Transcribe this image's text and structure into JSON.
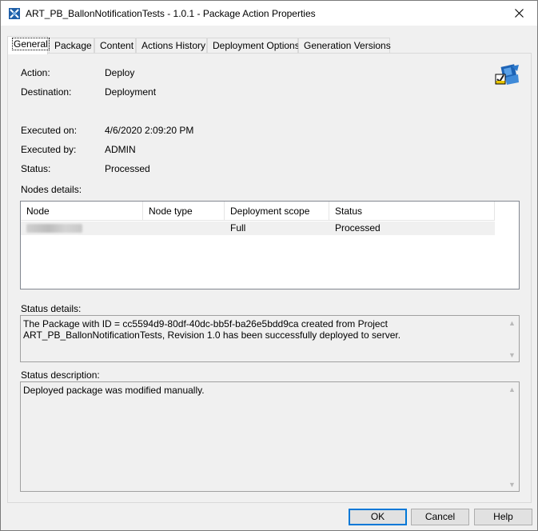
{
  "window": {
    "title": "ART_PB_BallonNotificationTests - 1.0.1 - Package Action Properties"
  },
  "tabs": [
    {
      "label": "General",
      "active": true
    },
    {
      "label": "Package",
      "active": false
    },
    {
      "label": "Content",
      "active": false
    },
    {
      "label": "Actions History",
      "active": false
    },
    {
      "label": "Deployment Options",
      "active": false
    },
    {
      "label": "Generation Versions",
      "active": false
    }
  ],
  "general": {
    "action_label": "Action:",
    "action_value": "Deploy",
    "destination_label": "Destination:",
    "destination_value": "Deployment",
    "executed_on_label": "Executed on:",
    "executed_on_value": "4/6/2020 2:09:20 PM",
    "executed_by_label": "Executed by:",
    "executed_by_value": "ADMIN",
    "status_label": "Status:",
    "status_value": "Processed",
    "nodes_details_label": "Nodes details:",
    "status_details_label": "Status details:",
    "status_details_text": "The Package with ID = cc5594d9-80df-40dc-bb5f-ba26e5bdd9ca created from Project ART_PB_BallonNotificationTests, Revision 1.0 has been successfully deployed to server.",
    "status_description_label": "Status description:",
    "status_description_text": "Deployed package was modified manually."
  },
  "nodes_table": {
    "columns": [
      "Node",
      "Node type",
      "Deployment scope",
      "Status"
    ],
    "rows": [
      {
        "node": "",
        "node_type": "",
        "deployment_scope": "Full",
        "status": "Processed"
      }
    ]
  },
  "buttons": {
    "ok": "OK",
    "cancel": "Cancel",
    "help": "Help"
  },
  "icons": {
    "app": "package-properties-icon",
    "close": "close-icon",
    "package": "package-deploy-icon"
  },
  "colors": {
    "accent": "#0078d7",
    "window_bg": "#f0f0f0",
    "titlebar_bg": "#ffffff"
  }
}
